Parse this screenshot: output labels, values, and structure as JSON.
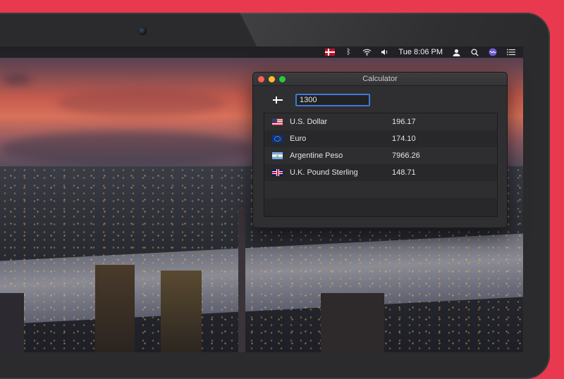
{
  "menubar": {
    "time": "Tue 8:06 PM",
    "icons": [
      "denmark-flag-icon",
      "bluetooth-icon",
      "wifi-icon",
      "volume-icon",
      "user-icon",
      "search-icon",
      "siri-icon",
      "notification-center-icon"
    ]
  },
  "window": {
    "title": "Calculator",
    "input": {
      "currency_flag": "denmark-flag-icon",
      "amount": "1300"
    },
    "rows": [
      {
        "flag": "us-flag-icon",
        "name": "U.S. Dollar",
        "value": "196.17"
      },
      {
        "flag": "eu-flag-icon",
        "name": "Euro",
        "value": "174.10"
      },
      {
        "flag": "argentina-flag-icon",
        "name": "Argentine Peso",
        "value": "7966.26"
      },
      {
        "flag": "uk-flag-icon",
        "name": "U.K. Pound Sterling",
        "value": "148.71"
      }
    ]
  },
  "colors": {
    "background": "#e8394f",
    "focus_ring": "#3d7bd6",
    "close": "#fc5f57",
    "minimize": "#fdbc2e",
    "maximize": "#28c840"
  }
}
